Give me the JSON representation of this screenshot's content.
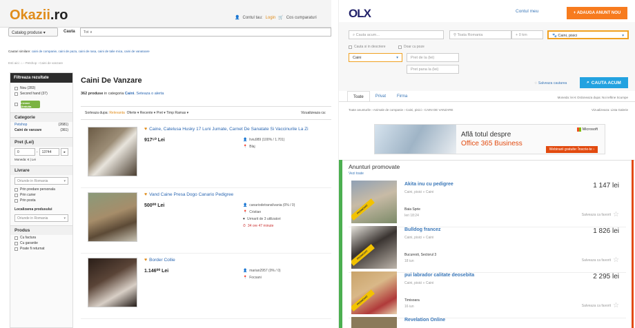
{
  "okazii": {
    "logo_main": "Okazii",
    "logo_tld": ".ro",
    "account_label": "Contul tau:",
    "login": "Login",
    "buy_label": "Cos cumparaturi",
    "catalog_btn": "Catalog produse ▾",
    "cauta_label": "Cauta",
    "search_scope": "Tot ∨",
    "similar_prefix": "Cautari similare:",
    "similar_links": "caini de companie, caini de paza, caini de rasa, caini de talie mica, caini de vanatoare",
    "breadcrumb": "Esti aici: ⌂ › Petshop › Caini de vanzare",
    "sidebar": {
      "header": "Filtreaza rezultate",
      "conditions": [
        {
          "label": "Nou (283)"
        },
        {
          "label": "Second hand (37)"
        }
      ],
      "livrare_badge": "Livrare Gratuita",
      "categorie_title": "Categorie",
      "categories": [
        {
          "name": "Petshop",
          "count": "(2681)"
        },
        {
          "name": "Caini de vanzare",
          "count": "(361)"
        }
      ],
      "pret_title": "Pret (Lei)",
      "price_min": "0",
      "price_max": "13744",
      "moneda": "Moneda: € | Lei",
      "livrare_title": "Livrare",
      "livrare_select": "Oriunde in Romania",
      "livrare_options": [
        "Prin predare personala",
        "Prin curier",
        "Prin posta"
      ],
      "localizare_title": "Localizarea produsului",
      "localizare_select": "Oriunde in Romania",
      "produs_title": "Produs",
      "produs_options": [
        "Cu factura",
        "Cu garantie",
        "Poate fi returnat"
      ]
    },
    "main_title": "Caini De Vanzare",
    "count_num": "362 produse",
    "count_mid": "in categoria",
    "count_cat": "Caini",
    "count_alert": "Seteaza o alerta",
    "sort_prefix": "Sorteaza dupa:",
    "sort_active": "Relevanta",
    "sort_rest": "Oferte ▾   Recente ▾   Pret ▾   Timp Ramas ▾",
    "view_label": "Vizualizeaza ca:",
    "items": [
      {
        "title": "Caine, Catelusa Husky 17 Luni Jumate, Carnet De Sanatate Si Vaccinurile La Zi",
        "price": "917⁵⁰ Lei",
        "seller": "liviu989 (100% / 1.701)",
        "loc": "Blaj",
        "extra1": "",
        "extra2": ""
      },
      {
        "title": "Vand Caine Presa Dogo Canario Pedigree",
        "price": "500⁰⁰ Lei",
        "seller": "canariodetransilvania (0% / 0)",
        "loc": "Cristian",
        "extra1": "Urmarit de 3 utilizatori",
        "extra2": "34 ore 47 minute"
      },
      {
        "title": "Border Collie",
        "price": "1.146⁰⁰ Lei",
        "seller": "marian2957 (0% / 0)",
        "loc": "Focsani",
        "extra1": "",
        "extra2": ""
      }
    ]
  },
  "olx": {
    "logo": "OLX",
    "contul": "Contul meu",
    "adauga": "+ ADAUGA ANUNT NOU",
    "search_placeholder": "Cauta acum...",
    "location_placeholder": "Toata Romania",
    "distance": "+ 0 km",
    "category_value": "Caini, pisici",
    "chk_title": "Cauta si in descriere",
    "chk_photo": "Doar cu poze",
    "subcat_value": "Caini",
    "price_from": "Pret de la (lei)",
    "price_to": "Pret pana la (lei)",
    "save_search": "Salveaza cautarea",
    "search_btn": "CAUTA ACUM",
    "tabs": [
      "Toate",
      "Privat",
      "Firma"
    ],
    "moneda_line": "Moneda:  lei  €     Ordoneaza dupa:  Noi  Ieftine  Scumpe",
    "breadcrumb": "Toate anunturile  ›  Animale de companie  ›  Caini, pisici  ›  CAINI DE VANZARE",
    "viz_line": "Vizualizeaza:  Lista  Galerie",
    "ad_line1": "Află totul despre",
    "ad_line2": "Office 365 Business",
    "ad_brand": "Microsoft",
    "ad_cta": "Webinarii gratuite: Înscrie-te ›",
    "promo_header": "Anunturi promovate",
    "promo_all": "Vezi toate",
    "promo_badge": "PROMOVAT",
    "fav_label": "Salveaza ca favorit",
    "promoted": [
      {
        "title": "Akita inu cu pedigree",
        "cat": "Caini, pisici » Caini",
        "loc": "Baia Sprie",
        "time": "Ieri 18:24",
        "price": "1 147 lei"
      },
      {
        "title": "Bulldog francez",
        "cat": "Caini, pisici » Caini",
        "loc": "Bucuresti, Sectorul 3",
        "time": "18 iun",
        "price": "1 826 lei"
      },
      {
        "title": "pui labrador calitate deosebita",
        "cat": "Caini, pisici » Caini",
        "loc": "Timisoara",
        "time": "16 iun",
        "price": "2 295 lei"
      }
    ],
    "last_ad": "Revelation Online"
  },
  "colors": {
    "okazii_orange": "#e08c1a",
    "link_blue": "#2a66b1",
    "olx_orange": "#f77b1e",
    "olx_blue": "#23a2e0"
  }
}
